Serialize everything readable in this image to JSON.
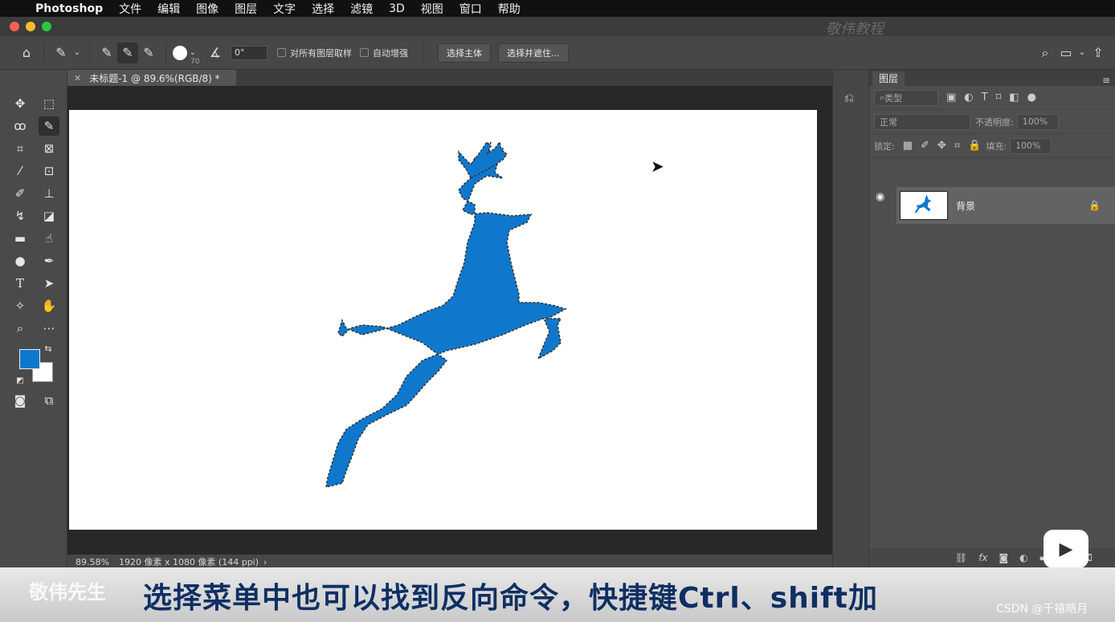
{
  "menubar": {
    "app_name": "Photoshop",
    "items": [
      "文件",
      "编辑",
      "图像",
      "图层",
      "文字",
      "选择",
      "滤镜",
      "3D",
      "视图",
      "窗口",
      "帮助"
    ]
  },
  "titlebar": {
    "watermark": "敬伟教程"
  },
  "options_bar": {
    "brush_size": "70",
    "angle": "0°",
    "sample_all_layers": "对所有图层取样",
    "auto_enhance": "自动增强",
    "select_subject": "选择主体",
    "select_and_mask": "选择并遮住..."
  },
  "document": {
    "tab_title": "未标题-1 @ 89.6%(RGB/8) *",
    "zoom": "89.58%",
    "doc_info": "1920 像素 x 1080 像素 (144 ppi)",
    "accent_color": "#0F78CD"
  },
  "layers_panel": {
    "tab": "图层",
    "filter_placeholder": "类型",
    "blend_mode": "正常",
    "opacity_label": "不透明度:",
    "opacity_value": "100%",
    "lock_label": "锁定:",
    "fill_label": "填充:",
    "fill_value": "100%",
    "layer_name": "背景"
  },
  "overlay": {
    "subtitle": "选择菜单中也可以找到反向命令，快捷键Ctrl、shift加",
    "watermark_left": "敬伟先生",
    "watermark_right": "CSDN @千禧皓月"
  }
}
